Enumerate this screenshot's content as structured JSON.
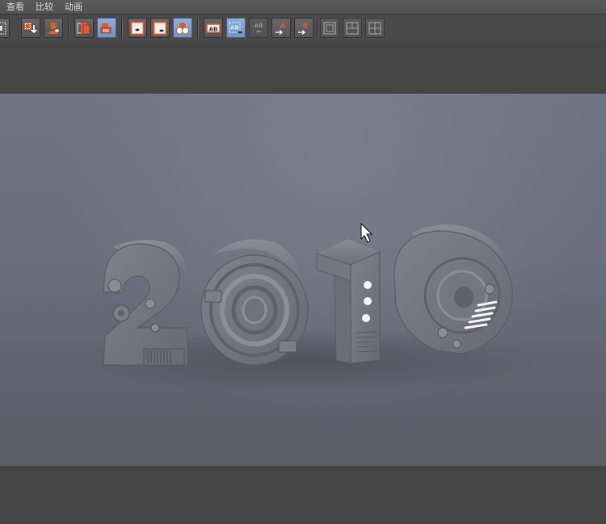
{
  "menubar": {
    "items": [
      "查看",
      "比较",
      "动画"
    ]
  },
  "toolbar": {
    "groups": [
      {
        "name": "display",
        "buttons": [
          "grid-fit-icon",
          "import-arrow-icon",
          "user-camera-icon"
        ]
      },
      {
        "name": "render",
        "buttons": [
          "render-region-icon",
          "render-to-picture-viewer-icon"
        ]
      },
      {
        "name": "view-mode",
        "buttons": [
          "view-a-icon",
          "view-b-icon",
          "view-ab-icon"
        ]
      },
      {
        "name": "compare",
        "buttons": [
          "compare-ab-icon",
          "compare-ab-split-icon",
          "compare-ab-swap-icon",
          "set-a-icon",
          "set-b-icon"
        ]
      },
      {
        "name": "layout",
        "buttons": [
          "layout-single-icon",
          "layout-split-icon",
          "layout-quad-icon"
        ]
      }
    ],
    "compare_labels": {
      "ab": "AB",
      "a": "A",
      "b": "B"
    }
  },
  "colors": {
    "accent_orange": "#e8572c",
    "active_blue": "#7d9fcb",
    "panel_bg": "#454545",
    "viewport_bg": "#6b6e7c",
    "model_gray": "#7b7d87"
  }
}
